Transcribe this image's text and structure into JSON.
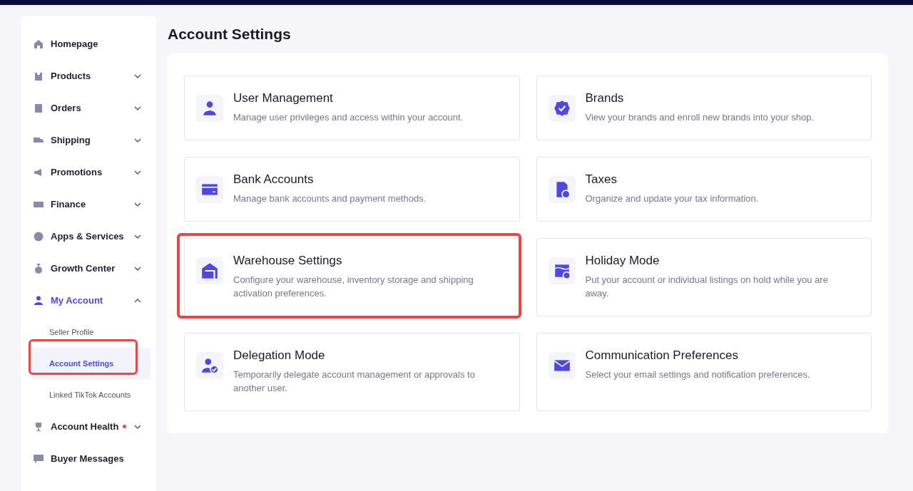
{
  "sidebar": {
    "items": [
      {
        "label": "Homepage",
        "expandable": false,
        "expanded": false,
        "selected": false,
        "alert": false
      },
      {
        "label": "Products",
        "expandable": true,
        "expanded": false,
        "selected": false,
        "alert": false
      },
      {
        "label": "Orders",
        "expandable": true,
        "expanded": false,
        "selected": false,
        "alert": false
      },
      {
        "label": "Shipping",
        "expandable": true,
        "expanded": false,
        "selected": false,
        "alert": false
      },
      {
        "label": "Promotions",
        "expandable": true,
        "expanded": false,
        "selected": false,
        "alert": false
      },
      {
        "label": "Finance",
        "expandable": true,
        "expanded": false,
        "selected": false,
        "alert": false
      },
      {
        "label": "Apps & Services",
        "expandable": true,
        "expanded": false,
        "selected": false,
        "alert": false
      },
      {
        "label": "Growth Center",
        "expandable": true,
        "expanded": false,
        "selected": false,
        "alert": false
      },
      {
        "label": "My Account",
        "expandable": true,
        "expanded": true,
        "selected": true,
        "alert": false,
        "children": [
          {
            "label": "Seller Profile",
            "selected": false,
            "highlighted": false
          },
          {
            "label": "Account Settings",
            "selected": true,
            "highlighted": true
          },
          {
            "label": "Linked TikTok Accounts",
            "selected": false,
            "highlighted": false
          }
        ]
      },
      {
        "label": "Account Health",
        "expandable": true,
        "expanded": false,
        "selected": false,
        "alert": true
      },
      {
        "label": "Buyer Messages",
        "expandable": false,
        "expanded": false,
        "selected": false,
        "alert": false
      }
    ]
  },
  "page": {
    "title": "Account Settings"
  },
  "cards": [
    {
      "title": "User Management",
      "description": "Manage user privileges and access within your account.",
      "highlighted": false
    },
    {
      "title": "Brands",
      "description": "View your brands and enroll new brands into your shop.",
      "highlighted": false
    },
    {
      "title": "Bank Accounts",
      "description": "Manage bank accounts and payment methods.",
      "highlighted": false
    },
    {
      "title": "Taxes",
      "description": "Organize and update your tax information.",
      "highlighted": false
    },
    {
      "title": "Warehouse Settings",
      "description": "Configure your warehouse, inventory storage and shipping activation preferences.",
      "highlighted": true
    },
    {
      "title": "Holiday Mode",
      "description": "Put your account or individual listings on hold while you are away.",
      "highlighted": false
    },
    {
      "title": "Delegation Mode",
      "description": "Temporarily delegate account management or approvals to another user.",
      "highlighted": false
    },
    {
      "title": "Communication Preferences",
      "description": "Select your email settings and notification preferences.",
      "highlighted": false
    }
  ]
}
